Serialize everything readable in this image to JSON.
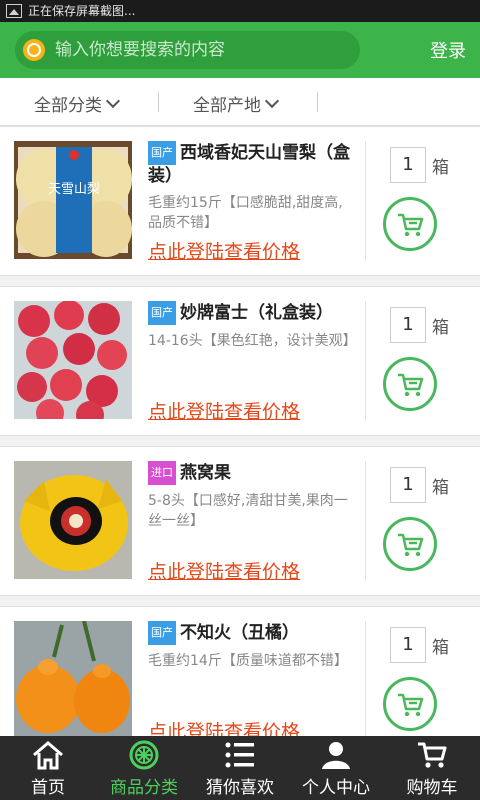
{
  "status_bar": {
    "text": "正在保存屏幕截图..."
  },
  "header": {
    "search_placeholder": "输入你想要搜索的内容",
    "login_label": "登录"
  },
  "filters": [
    {
      "label": "全部分类"
    },
    {
      "label": "全部产地"
    }
  ],
  "products": [
    {
      "badge": "国产",
      "badge_type": "domestic",
      "name": "西域香妃天山雪梨（盒装）",
      "desc": "毛重约15斤【口感脆甜,甜度高,品质不错】",
      "price_link": "点此登陆查看价格",
      "quantity": "1",
      "unit": "箱"
    },
    {
      "badge": "国产",
      "badge_type": "domestic",
      "name": "妙牌富士（礼盒装）",
      "desc": "14-16头【果色红艳，设计美观】",
      "price_link": "点此登陆查看价格",
      "quantity": "1",
      "unit": "箱"
    },
    {
      "badge": "进口",
      "badge_type": "import",
      "name": "燕窝果",
      "desc": "5-8头【口感好,清甜甘美,果肉一丝一丝】",
      "price_link": "点此登陆查看价格",
      "quantity": "1",
      "unit": "箱"
    },
    {
      "badge": "国产",
      "badge_type": "domestic",
      "name": "不知火（丑橘）",
      "desc": "毛重约14斤【质量味道都不错】",
      "price_link": "点此登陆查看价格",
      "quantity": "1",
      "unit": "箱"
    }
  ],
  "thumb_labels": {
    "pear_box": "天雪山梨"
  },
  "tabbar": [
    {
      "label": "首页",
      "icon": "home-icon"
    },
    {
      "label": "商品分类",
      "icon": "category-icon",
      "active": true
    },
    {
      "label": "猜你喜欢",
      "icon": "list-icon"
    },
    {
      "label": "个人中心",
      "icon": "person-icon"
    },
    {
      "label": "购物车",
      "icon": "cart-icon"
    }
  ],
  "colors": {
    "brand_green": "#3cb44a",
    "price_red": "#e24a1a",
    "import_badge": "#d94fd1",
    "domestic_badge": "#3a9ee6"
  }
}
